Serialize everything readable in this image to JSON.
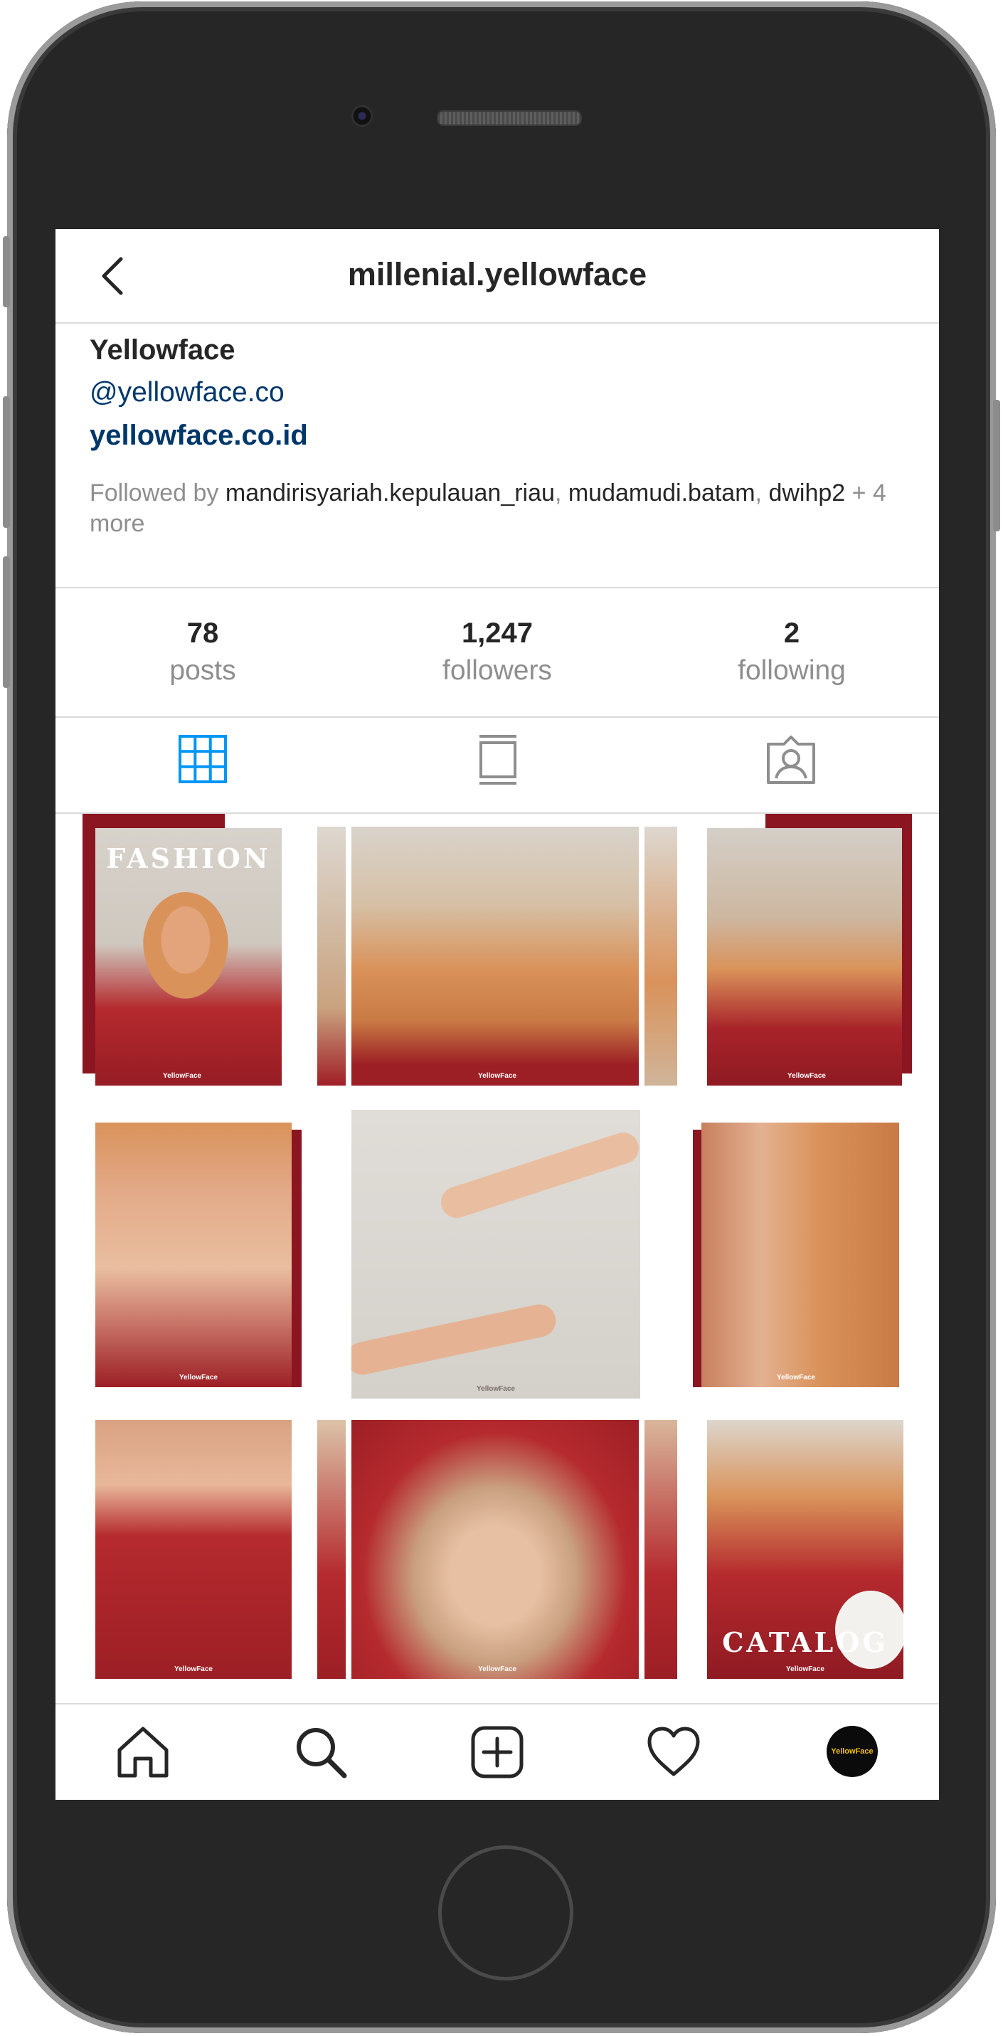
{
  "header": {
    "username": "millenial.yellowface"
  },
  "profile": {
    "name": "Yellowface",
    "link_handle": "@yellowface.co",
    "website": "yellowface.co.id",
    "followed_prefix": "Followed by ",
    "followed_users": [
      "mandirisyariah.kepulauan_riau",
      "mudamudi.batam",
      "dwihp2"
    ],
    "followed_more": " + 4 more"
  },
  "stats": [
    {
      "value": "78",
      "label": "posts"
    },
    {
      "value": "1,247",
      "label": "followers"
    },
    {
      "value": "2",
      "label": "following"
    }
  ],
  "tabs": [
    {
      "icon": "grid-icon",
      "active": true
    },
    {
      "icon": "feed-icon",
      "active": false
    },
    {
      "icon": "tagged-icon",
      "active": false
    }
  ],
  "posts": [
    {
      "caption": "YellowFace",
      "overlay": "FASHION"
    },
    {
      "caption": "YellowFace"
    },
    {
      "caption": "YellowFace"
    },
    {
      "caption": "YellowFace"
    },
    {
      "caption": "YellowFace"
    },
    {
      "caption": "YellowFace"
    },
    {
      "caption": "YellowFace"
    },
    {
      "caption": "YellowFace"
    },
    {
      "caption": "YellowFace",
      "overlay": "CATALOG"
    }
  ],
  "bottom_nav": {
    "items": [
      "home-icon",
      "search-icon",
      "new-post-icon",
      "activity-icon",
      "profile-avatar"
    ],
    "avatar_text": "YellowFace"
  },
  "colors": {
    "accent_blue": "#0095f6",
    "link": "#00376b",
    "brand_red": "#8b1520",
    "hair": "#d9925a"
  }
}
